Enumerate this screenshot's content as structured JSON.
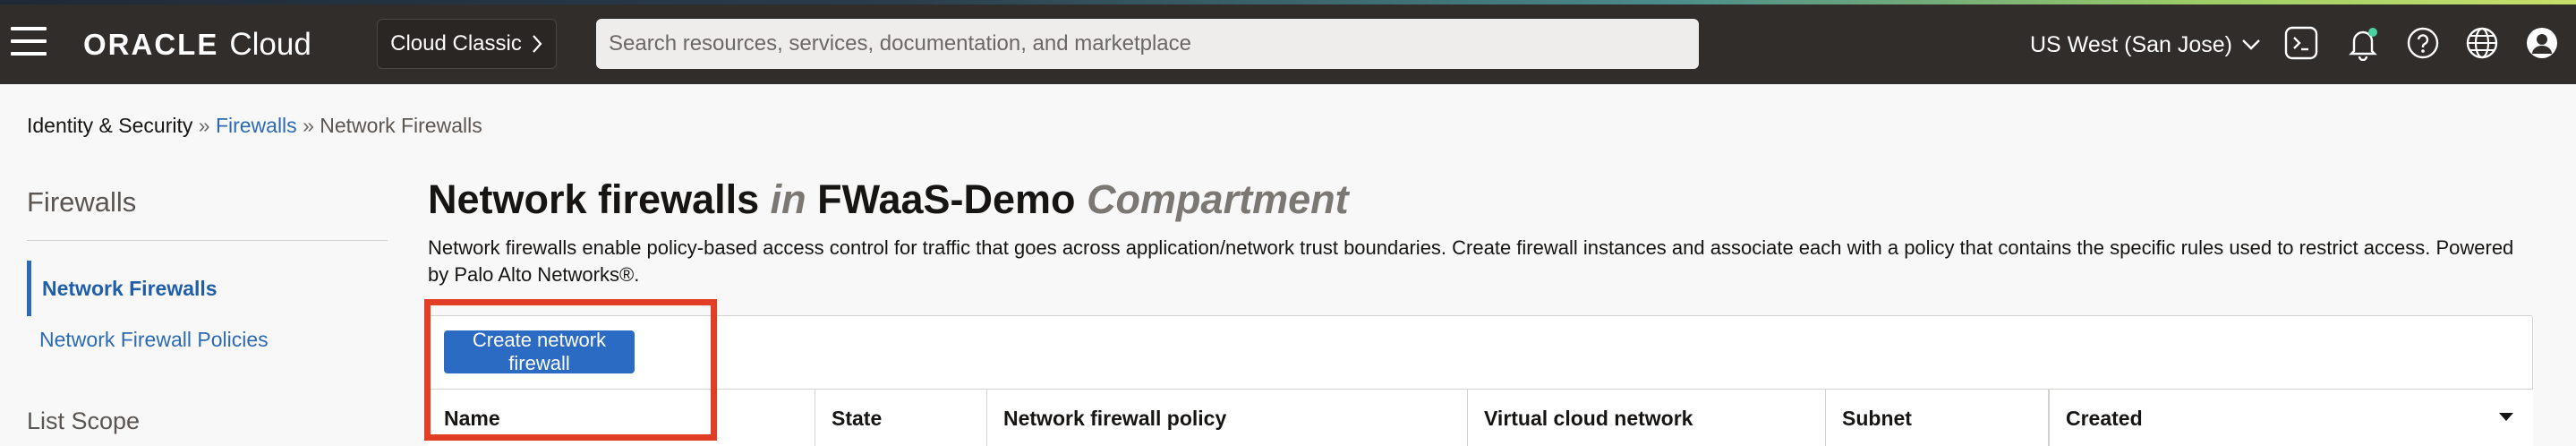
{
  "header": {
    "brand": "ORACLE",
    "product": "Cloud",
    "classic_label": "Cloud Classic",
    "search_placeholder": "Search resources, services, documentation, and marketplace",
    "region": "US West (San Jose)",
    "icons": [
      "menu-icon",
      "chevron-right-icon",
      "chevron-down-icon",
      "cloud-shell-icon",
      "bell-icon",
      "help-icon",
      "globe-icon",
      "user-icon"
    ],
    "accent_color": "#312d2a"
  },
  "breadcrumb": {
    "root": "Identity & Security",
    "sep1": "»",
    "firewalls": "Firewalls",
    "sep2": "»",
    "current": "Network Firewalls"
  },
  "sidebar": {
    "title": "Firewalls",
    "items": [
      {
        "label": "Network Firewalls",
        "active": true
      },
      {
        "label": "Network Firewall Policies",
        "active": false
      }
    ],
    "scope_title": "List Scope"
  },
  "main": {
    "title_prefix": "Network firewalls",
    "title_in": "in",
    "compartment": "FWaaS-Demo",
    "compartment_suffix": "Compartment",
    "description": "Network firewalls enable policy-based access control for traffic that goes across application/network trust boundaries. Create firewall instances and associate each with a policy that contains the specific rules used to restrict access. Powered by Palo Alto Networks®.",
    "create_button": "Create network firewall",
    "columns": [
      "Name",
      "State",
      "Network firewall policy",
      "Virtual cloud network",
      "Subnet",
      "Created"
    ],
    "primary_color": "#2c6bc4",
    "highlight_color": "#e23e26"
  }
}
